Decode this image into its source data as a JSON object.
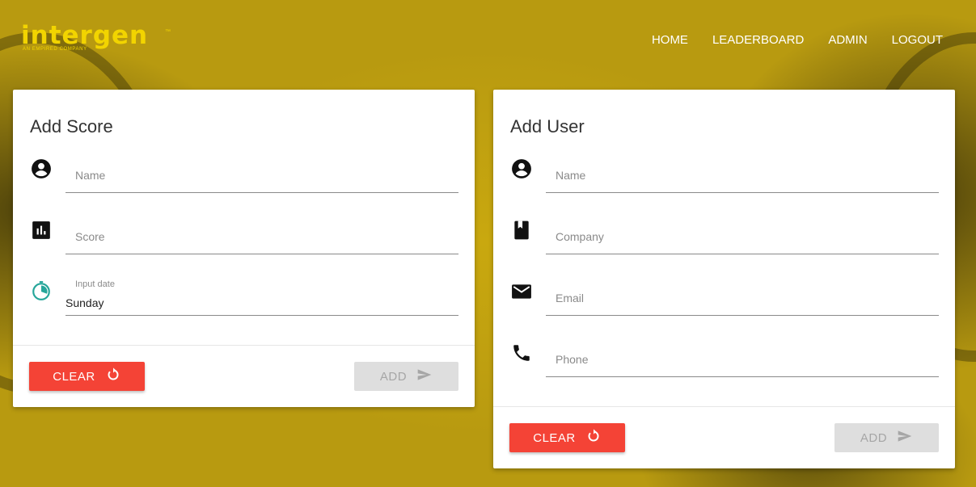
{
  "brand": {
    "name": "intergen",
    "tagline": "AN EMPIRED COMPANY",
    "tm": "™",
    "color": "#f2d400"
  },
  "nav": {
    "items": [
      {
        "label": "HOME"
      },
      {
        "label": "LEADERBOARD"
      },
      {
        "label": "ADMIN"
      },
      {
        "label": "LOGOUT"
      }
    ]
  },
  "add_score": {
    "title": "Add Score",
    "name_placeholder": "Name",
    "score_placeholder": "Score",
    "date_label": "Input date",
    "date_value": "Sunday",
    "clear_label": "CLEAR",
    "add_label": "ADD"
  },
  "add_user": {
    "title": "Add User",
    "name_placeholder": "Name",
    "company_placeholder": "Company",
    "email_placeholder": "Email",
    "phone_placeholder": "Phone",
    "clear_label": "CLEAR",
    "add_label": "ADD"
  },
  "colors": {
    "background": "#b59a12",
    "clear_button": "#f44336",
    "add_button_disabled": "#dedede",
    "date_icon": "#26a69a"
  },
  "icons": [
    "account-circle-icon",
    "bar-chart-icon",
    "timelapse-icon",
    "book-icon",
    "mail-icon",
    "phone-icon",
    "refresh-icon",
    "send-icon"
  ]
}
